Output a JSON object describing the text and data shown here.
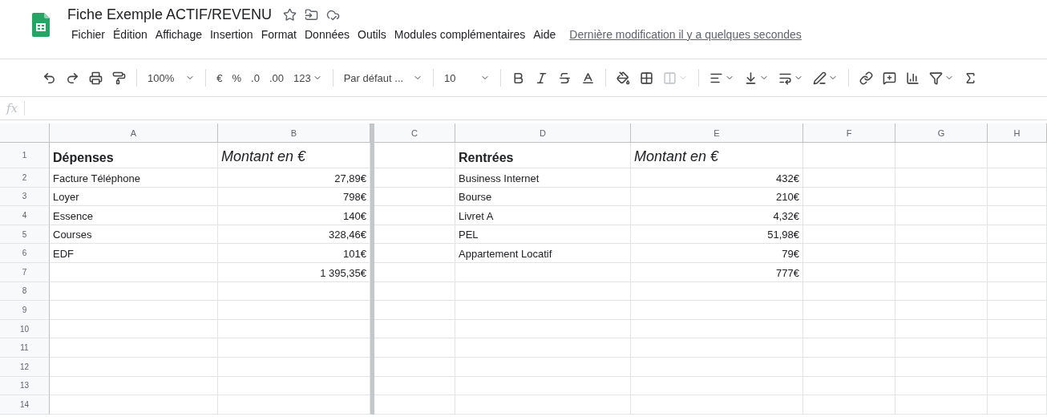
{
  "document": {
    "title": "Fiche Exemple ACTIF/REVENU",
    "starred": false
  },
  "menu": [
    {
      "label": "Fichier"
    },
    {
      "label": "Édition"
    },
    {
      "label": "Affichage"
    },
    {
      "label": "Insertion"
    },
    {
      "label": "Format"
    },
    {
      "label": "Données"
    },
    {
      "label": "Outils"
    },
    {
      "label": "Modules complémentaires"
    },
    {
      "label": "Aide"
    }
  ],
  "last_edit": "Dernière modification il y a quelques secondes",
  "toolbar": {
    "zoom": "100%",
    "currency": "€",
    "percent": "%",
    "decrease_decimals": ".0",
    "increase_decimals": ".00",
    "number_format": "123",
    "font": "Par défaut ...",
    "font_size": "10",
    "merge_disabled": true
  },
  "formula_bar": {
    "label": "fx"
  },
  "columns": [
    "A",
    "B",
    "C",
    "D",
    "E",
    "F",
    "G",
    "H"
  ],
  "rows": [
    {
      "number": "1",
      "kind": "heading",
      "expense_label": "Dépenses",
      "expense_amount": "Montant en €",
      "income_label": "Rentrées",
      "income_amount": "Montant en €"
    },
    {
      "number": "2",
      "kind": "data",
      "expense_label": "Facture Téléphone",
      "expense_amount": "27,89€",
      "income_label": "Business Internet",
      "income_amount": "432€"
    },
    {
      "number": "3",
      "kind": "data",
      "expense_label": "Loyer",
      "expense_amount": "798€",
      "income_label": "Bourse",
      "income_amount": "210€"
    },
    {
      "number": "4",
      "kind": "data",
      "expense_label": "Essence",
      "expense_amount": "140€",
      "income_label": "Livret A",
      "income_amount": "4,32€"
    },
    {
      "number": "5",
      "kind": "data",
      "expense_label": "Courses",
      "expense_amount": "328,46€",
      "income_label": "PEL",
      "income_amount": "51,98€"
    },
    {
      "number": "6",
      "kind": "data",
      "expense_label": "EDF",
      "expense_amount": "101€",
      "income_label": "Appartement Locatif",
      "income_amount": "79€"
    },
    {
      "number": "7",
      "kind": "data",
      "expense_amount": "1 395,35€",
      "income_amount": "777€"
    },
    {
      "number": "8",
      "kind": "data"
    },
    {
      "number": "9",
      "kind": "data"
    },
    {
      "number": "10",
      "kind": "data"
    },
    {
      "number": "11",
      "kind": "data"
    },
    {
      "number": "12",
      "kind": "data"
    },
    {
      "number": "13",
      "kind": "data"
    },
    {
      "number": "14",
      "kind": "data"
    }
  ]
}
